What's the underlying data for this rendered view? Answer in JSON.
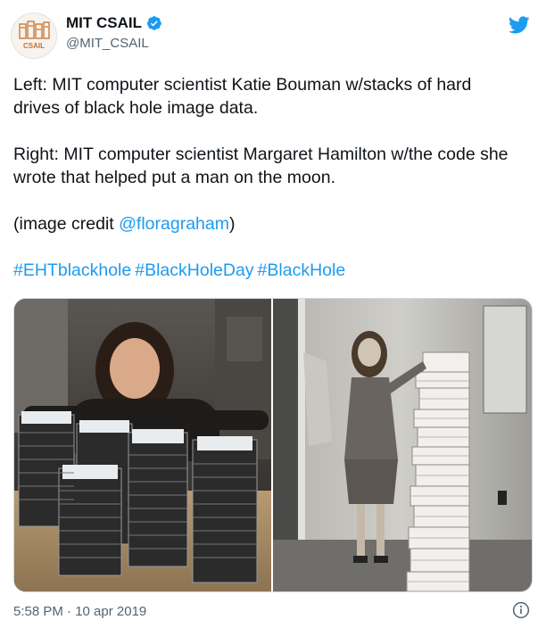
{
  "author": {
    "display_name": "MIT CSAIL",
    "handle": "@MIT_CSAIL",
    "avatar_text": "CSAIL",
    "verified": true
  },
  "tweet": {
    "paragraphs": [
      "Left: MIT computer scientist Katie Bouman w/stacks of hard drives of black hole image data.",
      "Right: MIT computer scientist Margaret Hamilton w/the code she wrote that helped put a man on the moon."
    ],
    "credit_prefix": "(image credit ",
    "credit_link": "@floragraham",
    "credit_suffix": ")",
    "hashtags": [
      "#EHTblackhole",
      "#BlackHoleDay",
      "#BlackHole"
    ]
  },
  "footer": {
    "timestamp": "5:58 PM · 10 apr 2019"
  },
  "icons": {
    "brand": "twitter-bird-icon",
    "verified": "verified-badge-icon",
    "info": "info-icon"
  },
  "colors": {
    "link": "#1d9bf0",
    "text": "#0f1419",
    "muted": "#536471"
  }
}
